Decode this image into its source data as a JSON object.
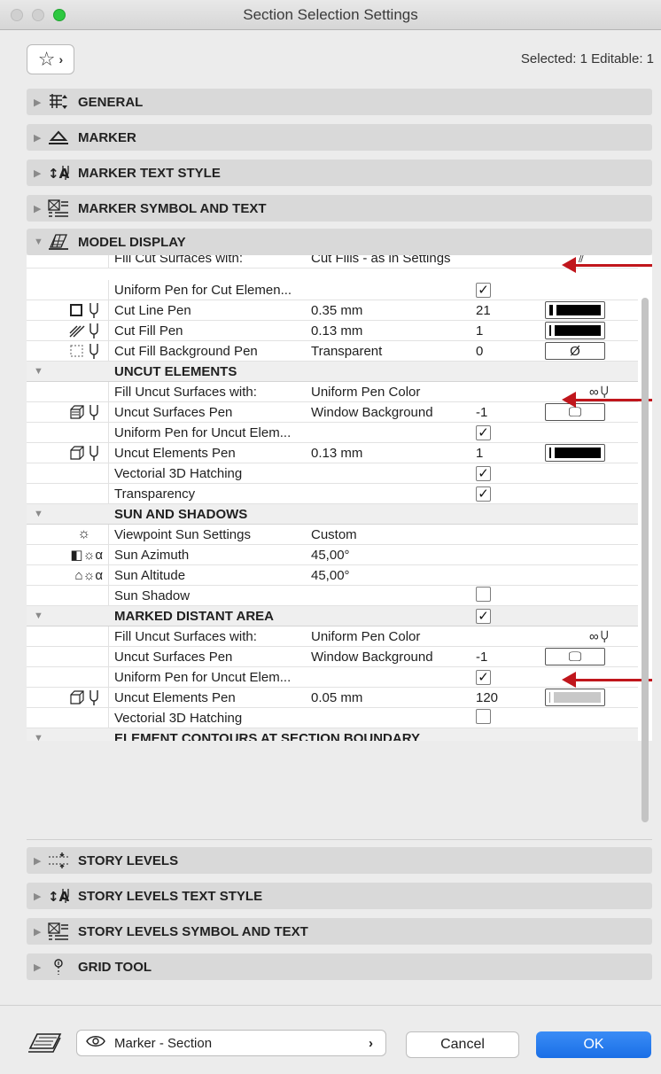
{
  "window": {
    "title": "Section Selection Settings"
  },
  "toolbar": {
    "favorites_icon": "star-icon",
    "selected_info": "Selected: 1 Editable: 1"
  },
  "sections_top": [
    {
      "label": "GENERAL",
      "icon": "general-icon"
    },
    {
      "label": "MARKER",
      "icon": "marker-icon"
    },
    {
      "label": "MARKER TEXT STYLE",
      "icon": "text-style-icon"
    },
    {
      "label": "MARKER SYMBOL AND TEXT",
      "icon": "symbol-text-icon"
    },
    {
      "label": "MODEL DISPLAY",
      "icon": "model-display-icon",
      "expanded": true
    }
  ],
  "model_display": {
    "rows": [
      {
        "name": "Fill Cut Surfaces with:",
        "value": "Cut Fills - as in Settings"
      },
      {
        "name": "Uniform Pen for Cut Elemen...",
        "checked": true
      },
      {
        "name": "Cut Line Pen",
        "value": "0.35 mm",
        "number": "21"
      },
      {
        "name": "Cut Fill Pen",
        "value": "0.13 mm",
        "number": "1"
      },
      {
        "name": "Cut Fill Background Pen",
        "value": "Transparent",
        "number": "0",
        "swatch": "Ø"
      }
    ],
    "uncut": {
      "title": "UNCUT ELEMENTS",
      "rows": [
        {
          "name": "Fill Uncut Surfaces with:",
          "value": "Uniform Pen Color"
        },
        {
          "name": "Uncut Surfaces Pen",
          "value": "Window Background",
          "number": "-1"
        },
        {
          "name": "Uniform Pen for Uncut Elem...",
          "checked": true
        },
        {
          "name": "Uncut Elements Pen",
          "value": "0.13 mm",
          "number": "1"
        },
        {
          "name": "Vectorial 3D Hatching",
          "checked": true
        },
        {
          "name": "Transparency",
          "checked": true
        }
      ]
    },
    "sun": {
      "title": "SUN AND SHADOWS",
      "rows": [
        {
          "name": "Viewpoint Sun Settings",
          "value": "Custom"
        },
        {
          "name": "Sun Azimuth",
          "value": "45,00°"
        },
        {
          "name": "Sun Altitude",
          "value": "45,00°"
        },
        {
          "name": "Sun Shadow",
          "checked": false
        }
      ]
    },
    "distant": {
      "title": "MARKED DISTANT AREA",
      "checked": true,
      "rows": [
        {
          "name": "Fill Uncut Surfaces with:",
          "value": "Uniform Pen Color"
        },
        {
          "name": "Uncut Surfaces Pen",
          "value": "Window Background",
          "number": "-1"
        },
        {
          "name": "Uniform Pen for Uncut Elem...",
          "checked": true
        },
        {
          "name": "Uncut Elements Pen",
          "value": "0.05 mm",
          "number": "120"
        },
        {
          "name": "Vectorial 3D Hatching",
          "checked": false
        }
      ]
    },
    "contours": {
      "title": "ELEMENT CONTOURS AT SECTION BOUNDARY"
    }
  },
  "sections_bottom": [
    {
      "label": "STORY LEVELS",
      "icon": "story-levels-icon"
    },
    {
      "label": "STORY LEVELS TEXT STYLE",
      "icon": "text-style-icon"
    },
    {
      "label": "STORY LEVELS SYMBOL AND TEXT",
      "icon": "symbol-text-icon"
    },
    {
      "label": "GRID TOOL",
      "icon": "grid-tool-icon"
    }
  ],
  "footer": {
    "layer": "Marker - Section",
    "cancel": "Cancel",
    "ok": "OK"
  },
  "colors": {
    "accent": "#1a6fe6",
    "annotation_arrow": "#c0161c",
    "zoom_button": "#2dc840"
  }
}
